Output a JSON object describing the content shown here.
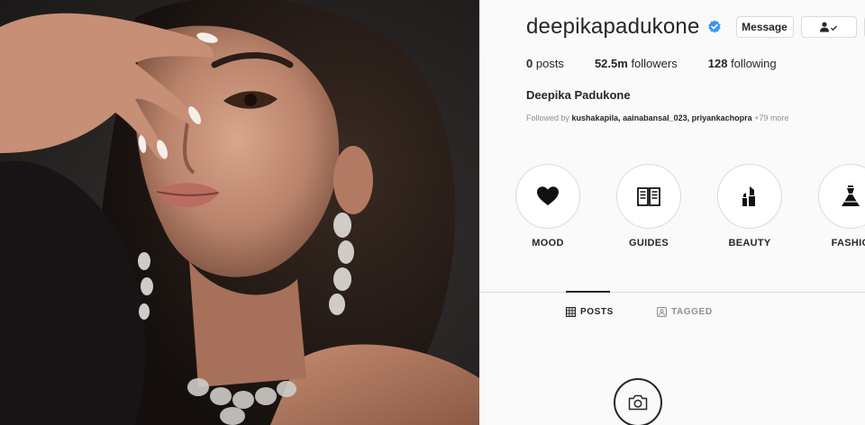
{
  "photo": {
    "alt": ""
  },
  "profile": {
    "username": "deepikapadukone",
    "verified": true,
    "buttons": {
      "message": "Message",
      "follow_icon": "person-check-icon",
      "more_icon": "chevron-down-icon"
    },
    "stats": {
      "posts_count": "0",
      "posts_label": "posts",
      "followers_count": "52.5m",
      "followers_label": "followers",
      "following_count": "128",
      "following_label": "following"
    },
    "full_name": "Deepika Padukone",
    "followed_by": {
      "prefix": "Followed by",
      "names": "kushakapila, aainabansal_023, priyankachopra",
      "more": "+79 more"
    },
    "highlights": [
      {
        "label": "MOOD",
        "icon": "heart-icon"
      },
      {
        "label": "GUIDES",
        "icon": "book-icon"
      },
      {
        "label": "BEAUTY",
        "icon": "lipstick-icon"
      },
      {
        "label": "FASHIO",
        "icon": "dress-icon"
      }
    ],
    "tabs": [
      {
        "label": "POSTS",
        "icon": "grid-icon",
        "active": true
      },
      {
        "label": "TAGGED",
        "icon": "tag-icon",
        "active": false
      }
    ],
    "empty_icon": "camera-icon"
  },
  "colors": {
    "text": "#262626",
    "muted": "#8e8e8e",
    "border": "#dbdbdb",
    "verified": "#3897f0",
    "background": "#fafafa"
  }
}
